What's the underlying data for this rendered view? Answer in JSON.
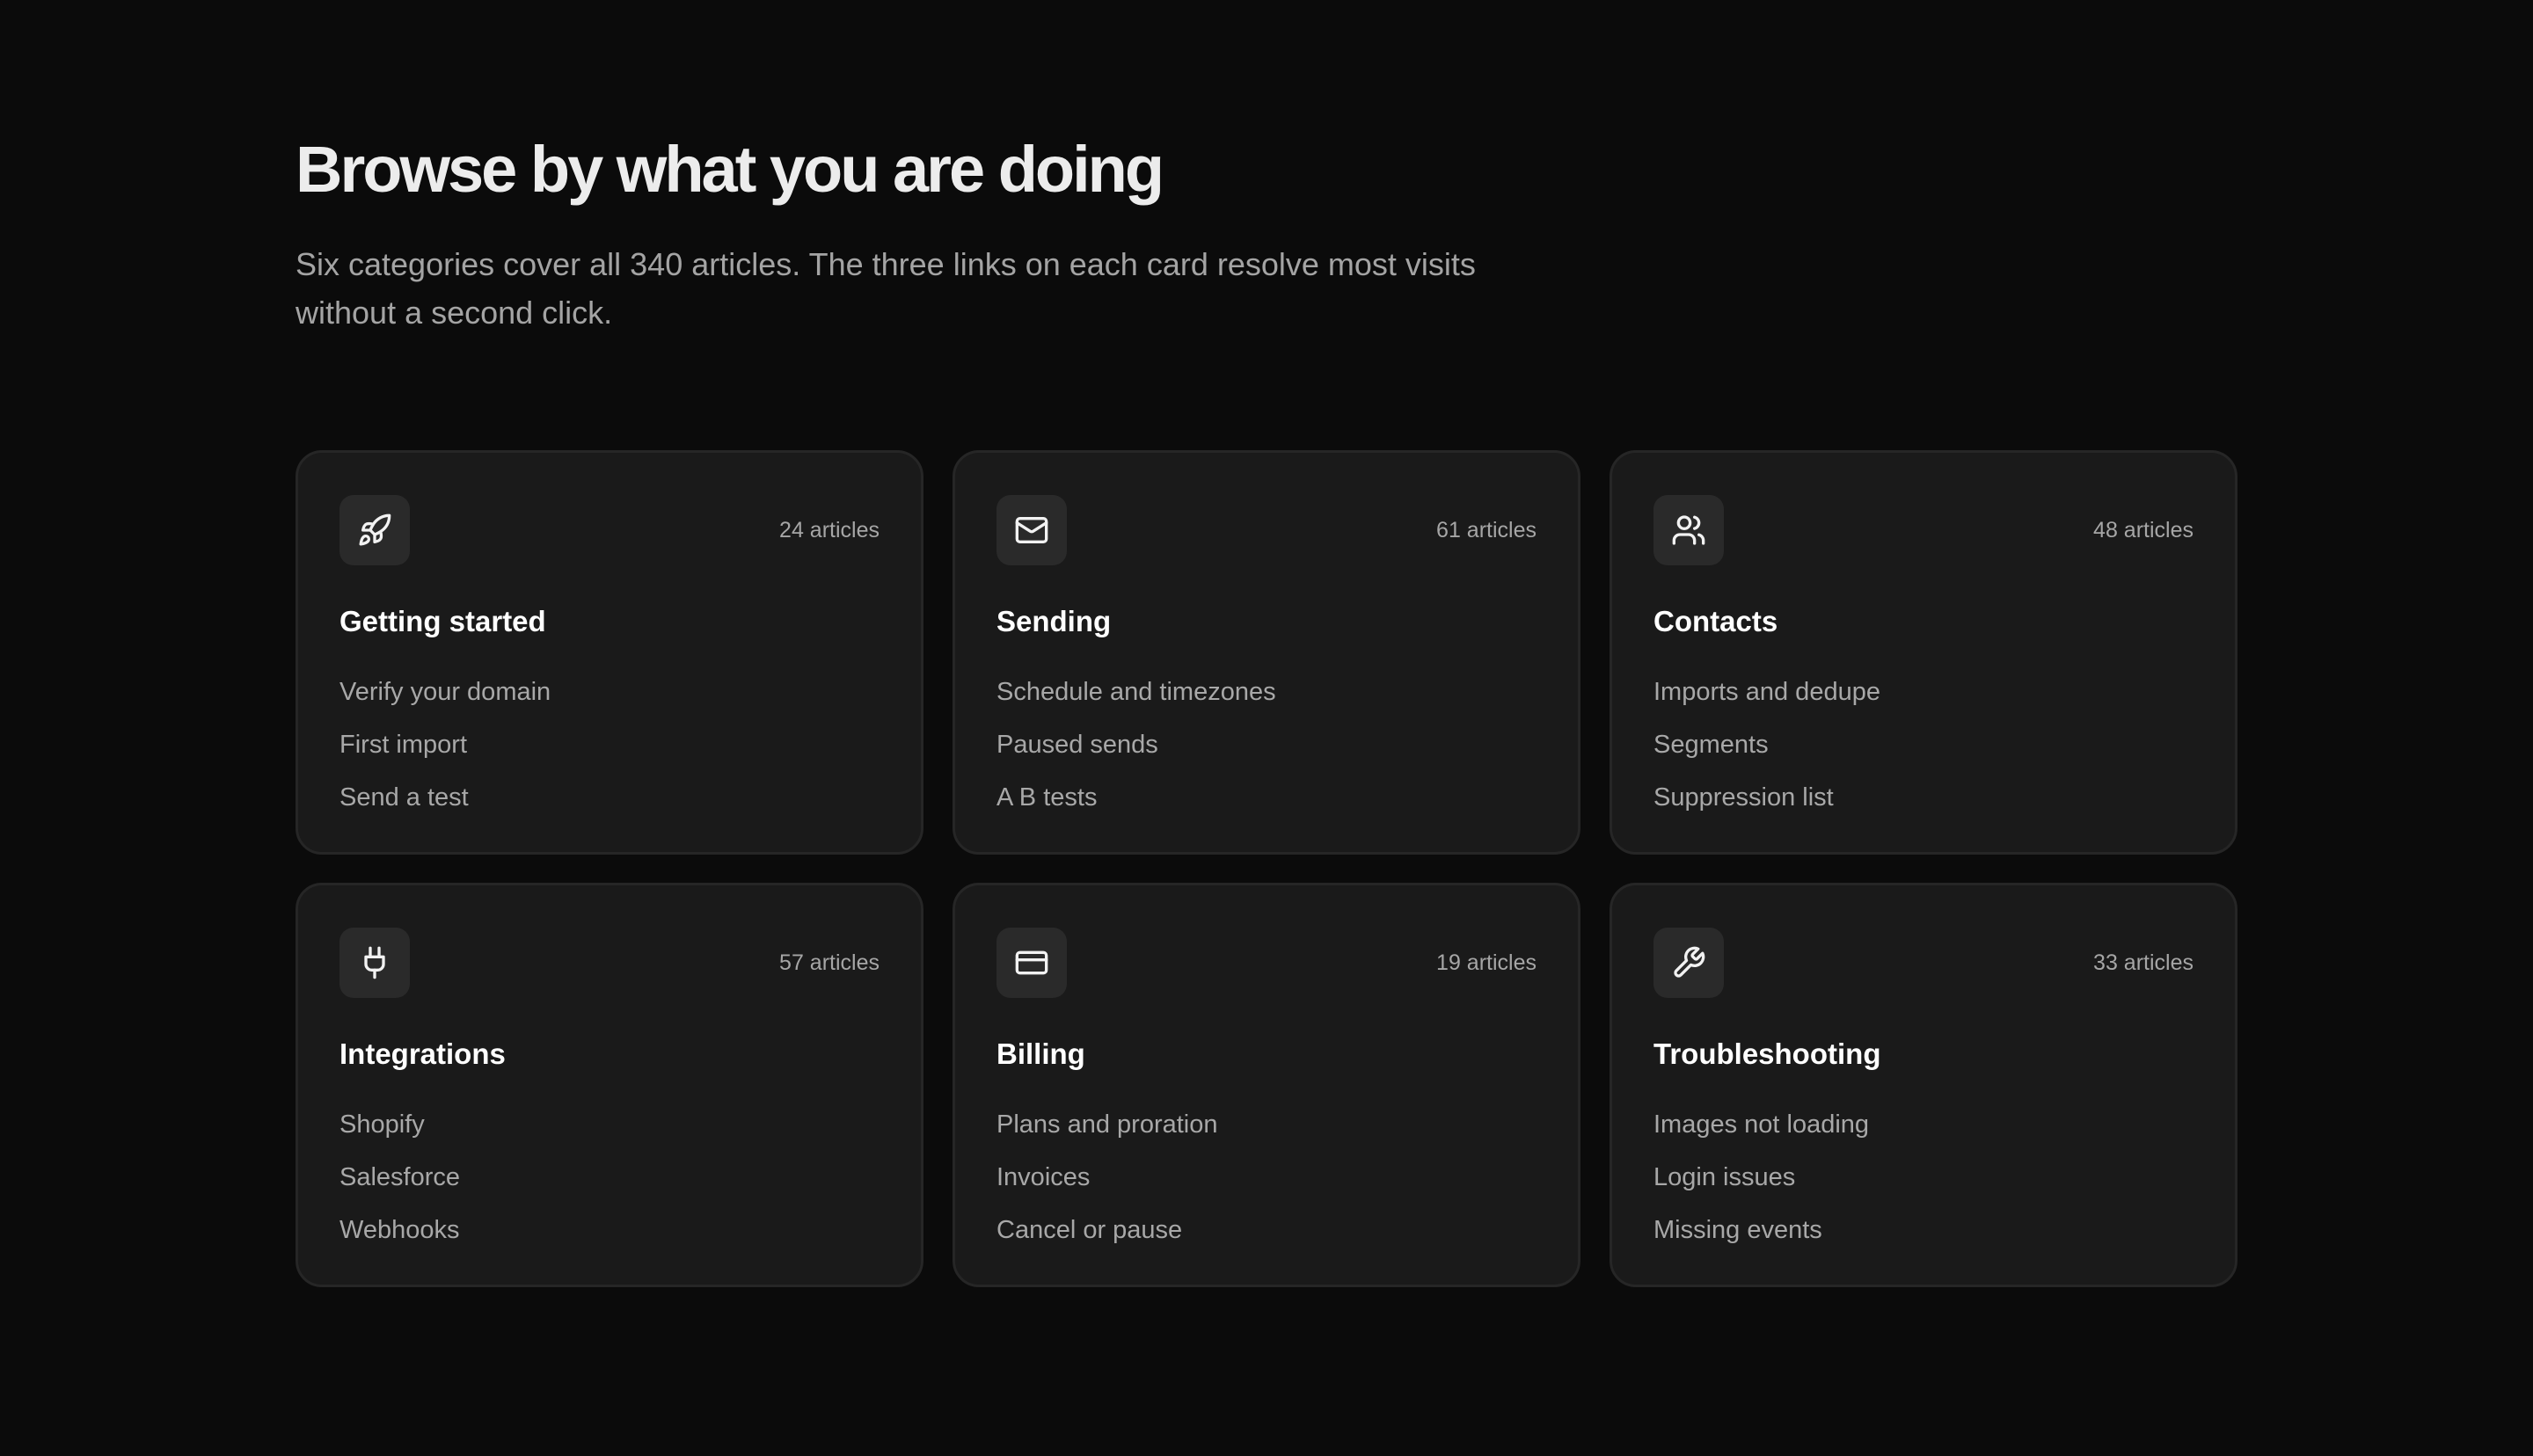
{
  "header": {
    "title": "Browse by what you are doing",
    "subtitle": "Six categories cover all 340 articles. The three links on each card resolve most visits without a second click."
  },
  "categories": [
    {
      "icon": "rocket-icon",
      "count": "24 articles",
      "title": "Getting started",
      "links": [
        "Verify your domain",
        "First import",
        "Send a test"
      ]
    },
    {
      "icon": "mail-icon",
      "count": "61 articles",
      "title": "Sending",
      "links": [
        "Schedule and timezones",
        "Paused sends",
        "A B tests"
      ]
    },
    {
      "icon": "users-icon",
      "count": "48 articles",
      "title": "Contacts",
      "links": [
        "Imports and dedupe",
        "Segments",
        "Suppression list"
      ]
    },
    {
      "icon": "plug-icon",
      "count": "57 articles",
      "title": "Integrations",
      "links": [
        "Shopify",
        "Salesforce",
        "Webhooks"
      ]
    },
    {
      "icon": "credit-card-icon",
      "count": "19 articles",
      "title": "Billing",
      "links": [
        "Plans and proration",
        "Invoices",
        "Cancel or pause"
      ]
    },
    {
      "icon": "wrench-icon",
      "count": "33 articles",
      "title": "Troubleshooting",
      "links": [
        "Images not loading",
        "Login issues",
        "Missing events"
      ]
    }
  ],
  "colors": {
    "background": "#0b0b0b",
    "card": "#1a1a1a",
    "card_border": "#262626",
    "icon_tile": "#2a2a2a",
    "muted_text": "#a8a8a8"
  }
}
